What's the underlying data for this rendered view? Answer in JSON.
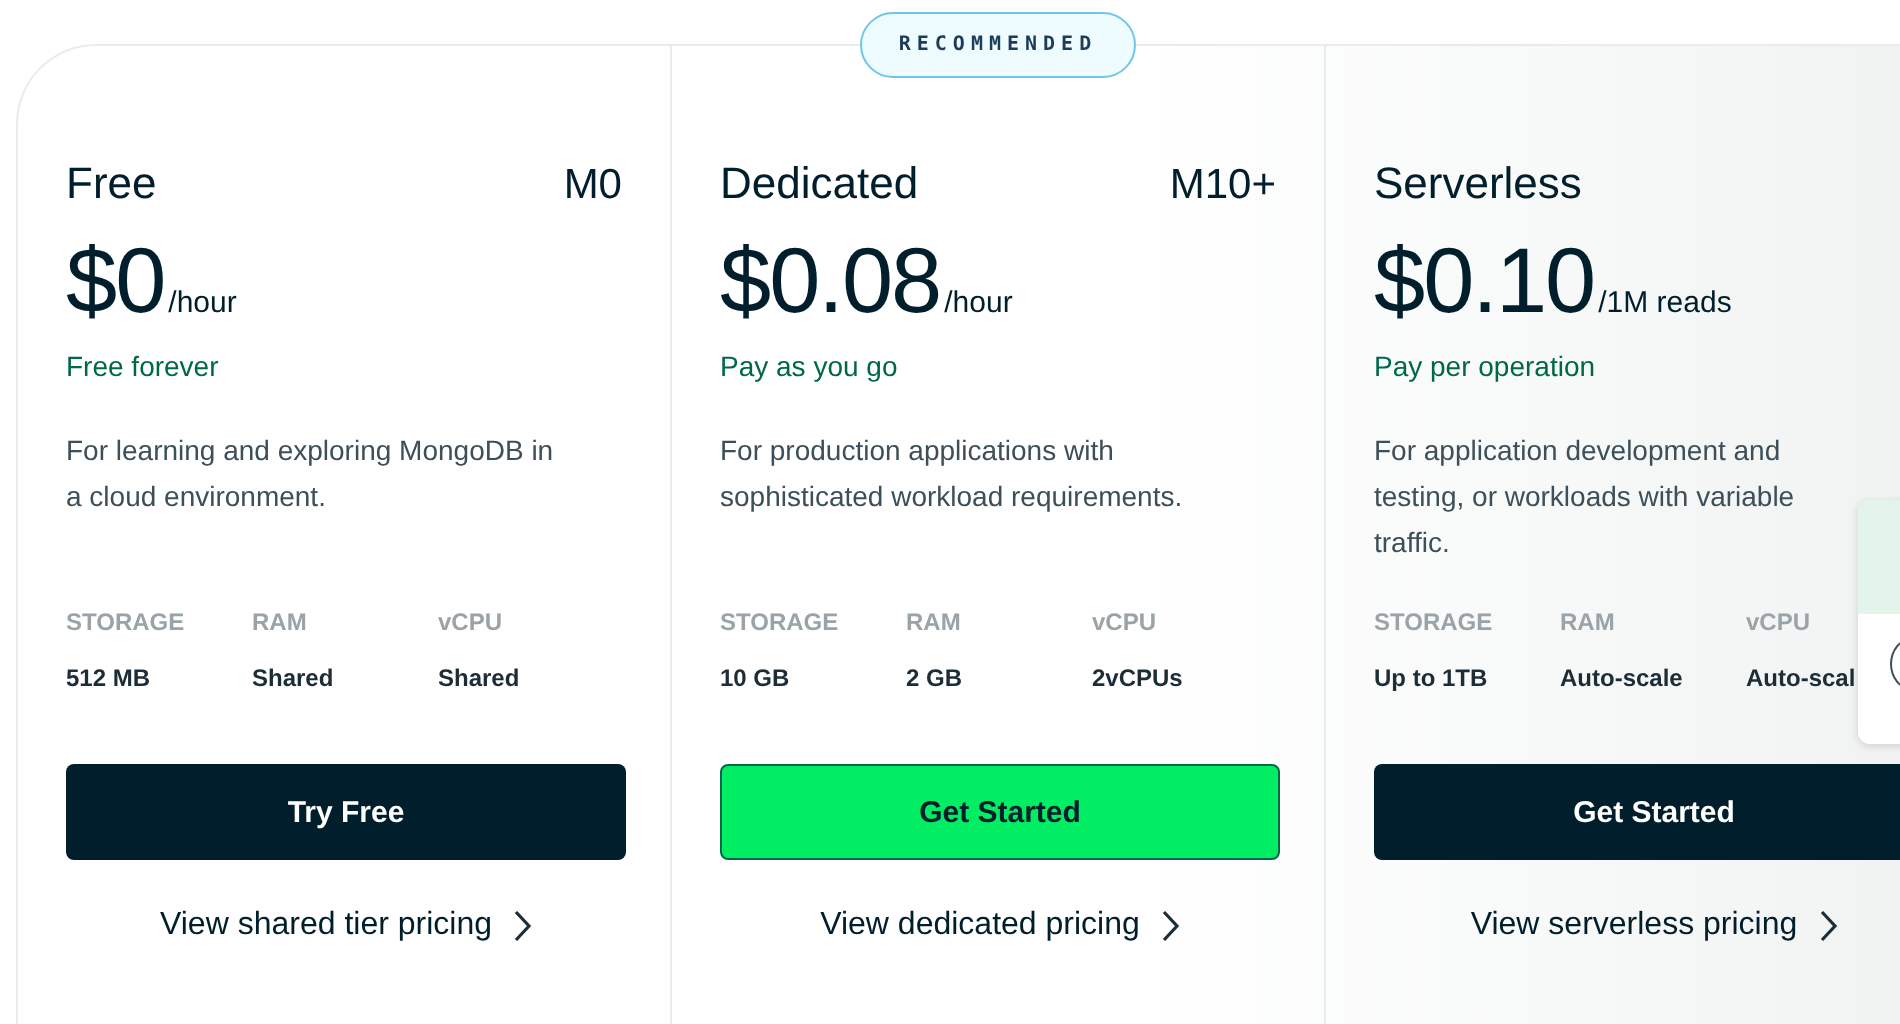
{
  "plans": [
    {
      "name": "Free",
      "tier": "M0",
      "price": "$0",
      "unit": "/hour",
      "note": "Free forever",
      "description": "For learning and exploring MongoDB in a cloud environment.",
      "specs": [
        {
          "label": "STORAGE",
          "value": "512 MB"
        },
        {
          "label": "RAM",
          "value": "Shared"
        },
        {
          "label": "vCPU",
          "value": "Shared"
        }
      ],
      "button": {
        "label": "Try Free",
        "kind": "dark"
      },
      "link": "View shared tier pricing"
    },
    {
      "name": "Dedicated",
      "tier": "M10+",
      "price": "$0.08",
      "unit": "/hour",
      "note": "Pay as you go",
      "description": "For production applications with sophisticated workload requirements.",
      "specs": [
        {
          "label": "STORAGE",
          "value": "10 GB"
        },
        {
          "label": "RAM",
          "value": "2 GB"
        },
        {
          "label": "vCPU",
          "value": "2vCPUs"
        }
      ],
      "button": {
        "label": "Get Started",
        "kind": "green"
      },
      "link": "View dedicated pricing",
      "badge": "RECOMMENDED"
    },
    {
      "name": "Serverless",
      "price": "$0.10",
      "unit": "/1M reads",
      "note": "Pay per operation",
      "description": "For application development and testing, or workloads with variable traffic.",
      "specs": [
        {
          "label": "STORAGE",
          "value": "Up to 1TB"
        },
        {
          "label": "RAM",
          "value": "Auto-scale"
        },
        {
          "label": "vCPU",
          "value": "Auto-scal"
        }
      ],
      "button": {
        "label": "Get Started",
        "kind": "dark"
      },
      "link": "View serverless pricing"
    }
  ]
}
